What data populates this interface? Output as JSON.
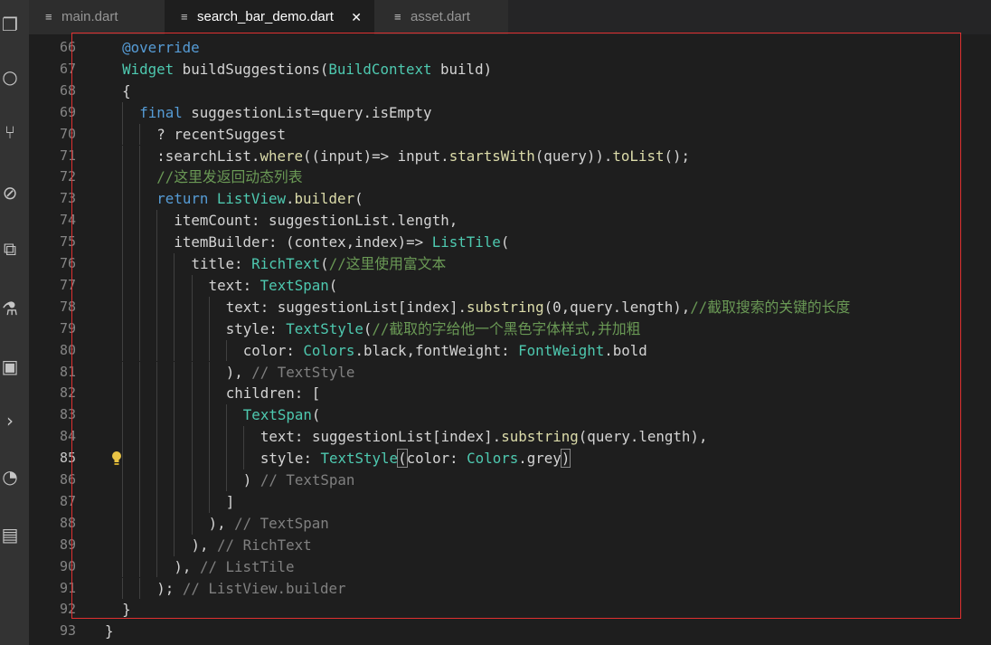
{
  "tabs": [
    {
      "label": "main.dart",
      "active": false
    },
    {
      "label": "search_bar_demo.dart",
      "active": true,
      "close": "✕"
    },
    {
      "label": "asset.dart",
      "active": false
    }
  ],
  "activity_icons": [
    "files-icon",
    "search-icon",
    "source-control-icon",
    "debug-icon",
    "extensions-icon",
    "test-flask-icon",
    "panels-icon",
    "chevron-right-icon",
    "gauge-icon",
    "docker-icon"
  ],
  "current_line": 85,
  "colors": {
    "keyword": "#569cd6",
    "type": "#4ec9b0",
    "function": "#dcdcaa",
    "comment": "#6a9955",
    "text": "#d4d4d4",
    "annotation": "#808080",
    "frame": "#e03030"
  },
  "lines": [
    {
      "n": "66",
      "indent": 2,
      "tokens": [
        {
          "t": "@override",
          "c": "kw"
        }
      ]
    },
    {
      "n": "67",
      "indent": 2,
      "tokens": [
        {
          "t": "Widget",
          "c": "type"
        },
        {
          "t": " buildSuggestions(",
          "c": "fg"
        },
        {
          "t": "BuildContext",
          "c": "type"
        },
        {
          "t": " build)",
          "c": "fg"
        }
      ]
    },
    {
      "n": "68",
      "indent": 2,
      "tokens": [
        {
          "t": "{",
          "c": "fg"
        }
      ]
    },
    {
      "n": "69",
      "indent": 4,
      "tokens": [
        {
          "t": "final",
          "c": "kw"
        },
        {
          "t": " suggestionList=query.isEmpty",
          "c": "fg"
        }
      ]
    },
    {
      "n": "70",
      "indent": 6,
      "tokens": [
        {
          "t": "? recentSuggest",
          "c": "fg"
        }
      ]
    },
    {
      "n": "71",
      "indent": 6,
      "tokens": [
        {
          "t": ":searchList.",
          "c": "fg"
        },
        {
          "t": "where",
          "c": "fn"
        },
        {
          "t": "((input)=> input.",
          "c": "fg"
        },
        {
          "t": "startsWith",
          "c": "fn"
        },
        {
          "t": "(query)).",
          "c": "fg"
        },
        {
          "t": "toList",
          "c": "fn"
        },
        {
          "t": "();",
          "c": "fg"
        }
      ]
    },
    {
      "n": "72",
      "indent": 6,
      "tokens": [
        {
          "t": "//这里发返回动态列表",
          "c": "cm"
        }
      ]
    },
    {
      "n": "73",
      "indent": 6,
      "tokens": [
        {
          "t": "return",
          "c": "kw"
        },
        {
          "t": " ",
          "c": "fg"
        },
        {
          "t": "ListView",
          "c": "type"
        },
        {
          "t": ".",
          "c": "fg"
        },
        {
          "t": "builder",
          "c": "fn"
        },
        {
          "t": "(",
          "c": "fg"
        }
      ]
    },
    {
      "n": "74",
      "indent": 8,
      "tokens": [
        {
          "t": "itemCount: suggestionList.length,",
          "c": "fg"
        }
      ]
    },
    {
      "n": "75",
      "indent": 8,
      "tokens": [
        {
          "t": "itemBuilder: (contex,index)=> ",
          "c": "fg"
        },
        {
          "t": "ListTile",
          "c": "type"
        },
        {
          "t": "(",
          "c": "fg"
        }
      ]
    },
    {
      "n": "76",
      "indent": 10,
      "tokens": [
        {
          "t": "title: ",
          "c": "fg"
        },
        {
          "t": "RichText",
          "c": "type"
        },
        {
          "t": "(",
          "c": "fg"
        },
        {
          "t": "//这里使用富文本",
          "c": "cm"
        }
      ]
    },
    {
      "n": "77",
      "indent": 12,
      "tokens": [
        {
          "t": "text: ",
          "c": "fg"
        },
        {
          "t": "TextSpan",
          "c": "type"
        },
        {
          "t": "(",
          "c": "fg"
        }
      ]
    },
    {
      "n": "78",
      "indent": 14,
      "tokens": [
        {
          "t": "text: suggestionList[index].",
          "c": "fg"
        },
        {
          "t": "substring",
          "c": "fn"
        },
        {
          "t": "(0,query.length),",
          "c": "fg"
        },
        {
          "t": "//截取搜索的关键的长度",
          "c": "cm"
        }
      ]
    },
    {
      "n": "79",
      "indent": 14,
      "tokens": [
        {
          "t": "style: ",
          "c": "fg"
        },
        {
          "t": "TextStyle",
          "c": "type"
        },
        {
          "t": "(",
          "c": "fg"
        },
        {
          "t": "//截取的字给他一个黑色字体样式,并加粗",
          "c": "cm"
        }
      ]
    },
    {
      "n": "80",
      "indent": 16,
      "tokens": [
        {
          "t": "color: ",
          "c": "fg"
        },
        {
          "t": "Colors",
          "c": "type"
        },
        {
          "t": ".black,fontWeight: ",
          "c": "fg"
        },
        {
          "t": "FontWeight",
          "c": "type"
        },
        {
          "t": ".bold",
          "c": "fg"
        }
      ]
    },
    {
      "n": "81",
      "indent": 14,
      "tokens": [
        {
          "t": "), ",
          "c": "fg"
        },
        {
          "t": "// TextStyle",
          "c": "dim"
        }
      ]
    },
    {
      "n": "82",
      "indent": 14,
      "tokens": [
        {
          "t": "children: [",
          "c": "fg"
        }
      ]
    },
    {
      "n": "83",
      "indent": 16,
      "tokens": [
        {
          "t": "TextSpan",
          "c": "type"
        },
        {
          "t": "(",
          "c": "fg"
        }
      ]
    },
    {
      "n": "84",
      "indent": 18,
      "tokens": [
        {
          "t": "text: suggestionList[index].",
          "c": "fg"
        },
        {
          "t": "substring",
          "c": "fn"
        },
        {
          "t": "(query.length),",
          "c": "fg"
        }
      ]
    },
    {
      "n": "85",
      "indent": 18,
      "tokens": [
        {
          "t": "style: ",
          "c": "fg"
        },
        {
          "t": "TextStyle",
          "c": "type"
        },
        {
          "t": "(",
          "c": "brk"
        },
        {
          "t": "color: ",
          "c": "fg"
        },
        {
          "t": "Colors",
          "c": "type"
        },
        {
          "t": ".grey",
          "c": "fg"
        },
        {
          "t": ")",
          "c": "brk"
        }
      ]
    },
    {
      "n": "86",
      "indent": 16,
      "tokens": [
        {
          "t": ") ",
          "c": "fg"
        },
        {
          "t": "// TextSpan",
          "c": "dim"
        }
      ]
    },
    {
      "n": "87",
      "indent": 14,
      "tokens": [
        {
          "t": "]",
          "c": "fg"
        }
      ]
    },
    {
      "n": "88",
      "indent": 12,
      "tokens": [
        {
          "t": "), ",
          "c": "fg"
        },
        {
          "t": "// TextSpan",
          "c": "dim"
        }
      ]
    },
    {
      "n": "89",
      "indent": 10,
      "tokens": [
        {
          "t": "), ",
          "c": "fg"
        },
        {
          "t": "// RichText",
          "c": "dim"
        }
      ]
    },
    {
      "n": "90",
      "indent": 8,
      "tokens": [
        {
          "t": "), ",
          "c": "fg"
        },
        {
          "t": "// ListTile",
          "c": "dim"
        }
      ]
    },
    {
      "n": "91",
      "indent": 6,
      "tokens": [
        {
          "t": "); ",
          "c": "fg"
        },
        {
          "t": "// ListView.builder",
          "c": "dim"
        }
      ]
    },
    {
      "n": "92",
      "indent": 2,
      "tokens": [
        {
          "t": "}",
          "c": "fg"
        }
      ]
    },
    {
      "n": "93",
      "indent": 0,
      "tokens": [
        {
          "t": "}",
          "c": "fg"
        }
      ]
    }
  ]
}
